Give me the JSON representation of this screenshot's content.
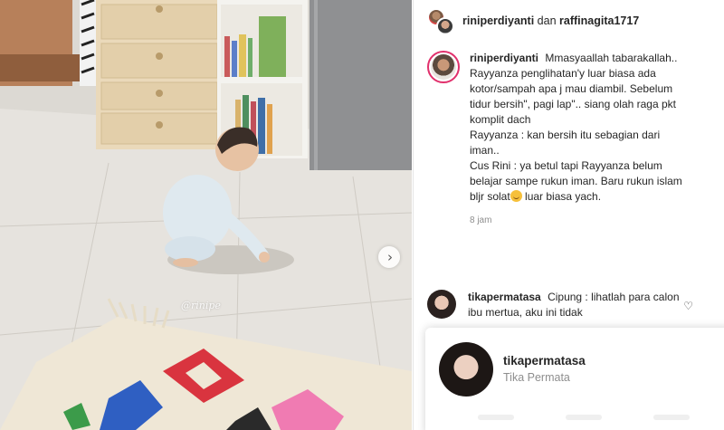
{
  "media": {
    "watermark": "@rinipe",
    "next_icon": "chevron-right-icon",
    "next_symbol": "›"
  },
  "header": {
    "user1": "riniperdiyanti",
    "joiner": "dan",
    "user2": "raffinagita1717"
  },
  "caption": {
    "user": "riniperdiyanti",
    "text_lines": [
      "Mmasyaallah tabarakallah.. Rayyanza penglihatan'y luar biasa ada kotor/sampah apa j mau diambil. Sebelum tidur bersih\", pagi lap\".. siang olah raga pkt komplit dach",
      "Rayyanza : kan bersih itu sebagian dari iman..",
      "Cus Rini : ya betul tapi Rayyanza belum belajar sampe rukun iman. Baru rukun islam bljr solat"
    ],
    "after_emoji": " luar biasa yach.",
    "emoji_icon": "smile-emoji-icon",
    "time": "8 jam"
  },
  "comment": {
    "user": "tikapermatasa",
    "text": "Cipung : lihatlah para calon ibu mertua, aku ini tidak",
    "like_icon": "heart-icon",
    "like_symbol": "♡"
  },
  "hover_card": {
    "username": "tikapermatasa",
    "full_name": "Tika Permata"
  },
  "colors": {
    "story_ring": "#e1306c",
    "muted_text": "#8e8e8e",
    "text": "#262626"
  }
}
